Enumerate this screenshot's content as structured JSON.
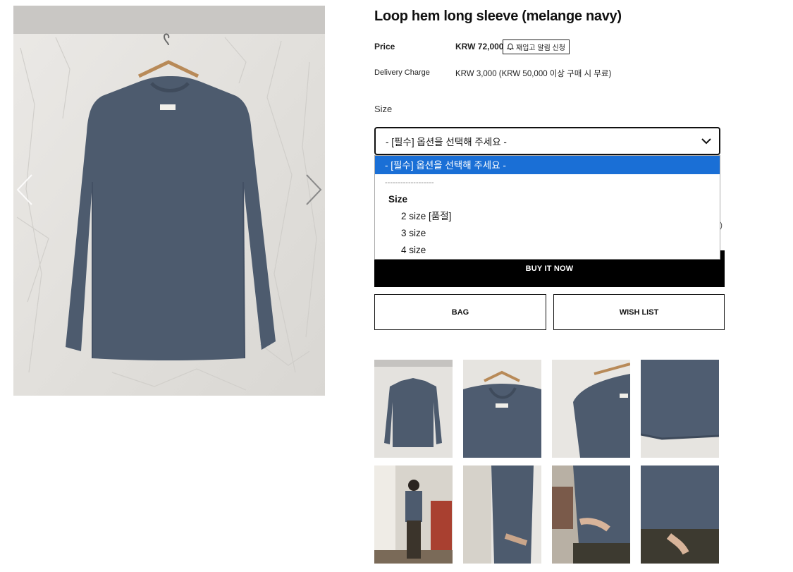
{
  "product": {
    "title": "Loop hem long sleeve (melange navy)",
    "price_label": "Price",
    "price_value": "KRW 72,000",
    "restock_label": "재입고 알림 신청",
    "delivery_label": "Delivery Charge",
    "delivery_value": "KRW 3,000 (KRW 50,000 이상 구매 시 무료)",
    "size_label": "Size"
  },
  "size_select": {
    "current_value": "- [필수] 옵션을 선택해 주세요 -",
    "options": {
      "placeholder": "- [필수] 옵션을 선택해 주세요 -",
      "divider": "-------------------",
      "group": "Size",
      "size2": "2 size [품절]",
      "size3": "3 size",
      "size4": "4 size"
    }
  },
  "hidden_edge_text": ")",
  "actions": {
    "buy_now": "BUY IT NOW",
    "bag": "BAG",
    "wishlist": "WISH LIST"
  },
  "colors": {
    "shirt": "#4d5b6e",
    "backdrop": "#e6e4e0",
    "selected_option": "#1a6fd6",
    "button_black": "#000000"
  },
  "icons": {
    "prev": "chevron-left-icon",
    "next": "chevron-right-icon",
    "select": "chevron-down-icon",
    "restock": "bell-icon"
  }
}
